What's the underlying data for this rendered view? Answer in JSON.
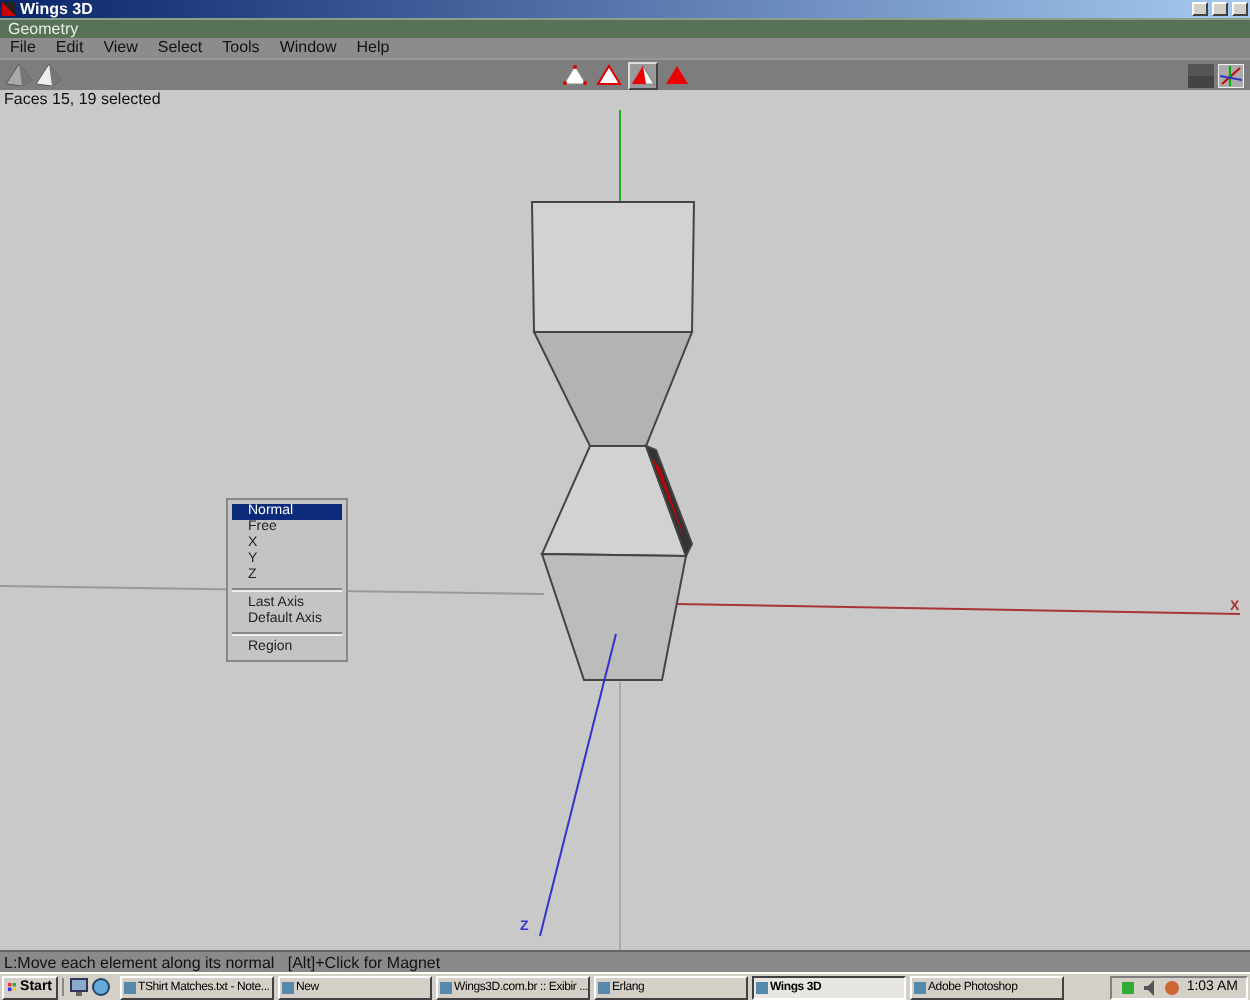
{
  "window": {
    "title": "Wings 3D"
  },
  "panel": {
    "title": "Geometry"
  },
  "menu": [
    "File",
    "Edit",
    "View",
    "Select",
    "Tools",
    "Window",
    "Help"
  ],
  "selection_modes": [
    {
      "kind": "vertex",
      "selected": false
    },
    {
      "kind": "edge",
      "selected": false
    },
    {
      "kind": "face",
      "selected": true
    },
    {
      "kind": "body",
      "selected": false
    }
  ],
  "info": "Faces 15, 19 selected",
  "viewport": {
    "axis_labels": [
      {
        "kind": "x",
        "text": "X"
      },
      {
        "kind": "z",
        "text": "Z"
      }
    ]
  },
  "popup_menu": [
    {
      "kind": "item",
      "label": "Normal",
      "selected": true
    },
    {
      "kind": "item",
      "label": "Free",
      "selected": false
    },
    {
      "kind": "item",
      "label": "X",
      "selected": false
    },
    {
      "kind": "item",
      "label": "Y",
      "selected": false
    },
    {
      "kind": "item",
      "label": "Z",
      "selected": false
    },
    {
      "kind": "separator"
    },
    {
      "kind": "item",
      "label": "Last Axis",
      "selected": false
    },
    {
      "kind": "item",
      "label": "Default Axis",
      "selected": false
    },
    {
      "kind": "separator"
    },
    {
      "kind": "item",
      "label": "Region",
      "selected": false
    }
  ],
  "status_bar": "L:Move each element along its normal   [Alt]+Click for Magnet",
  "taskbar": {
    "start": "Start",
    "tasks": [
      {
        "label": "TShirt Matches.txt - Note...",
        "selected": false
      },
      {
        "label": "New",
        "selected": false
      },
      {
        "label": "Wings3D.com.br :: Exibir ...",
        "selected": false
      },
      {
        "label": "Erlang",
        "selected": false
      },
      {
        "label": "Wings 3D",
        "selected": true
      },
      {
        "label": "Adobe Photoshop",
        "selected": false
      }
    ],
    "clock": "1:03 AM"
  }
}
